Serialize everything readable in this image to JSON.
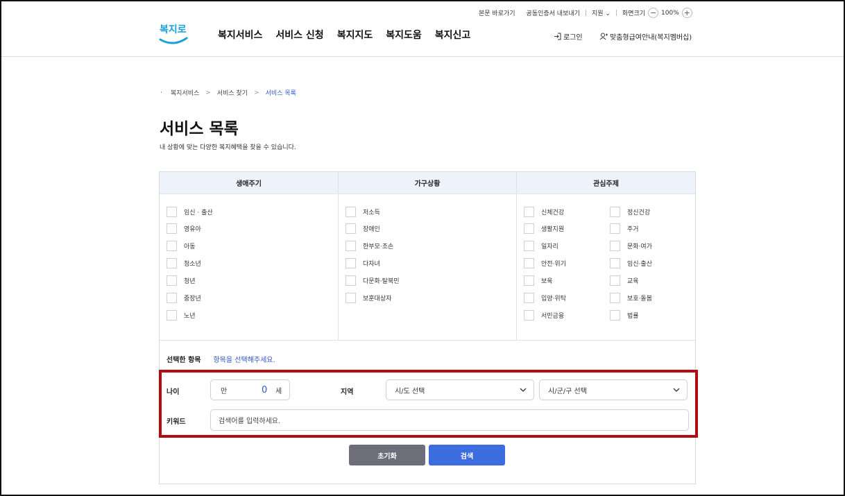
{
  "header": {
    "util": {
      "skip": "본문 바로가기",
      "cert": "공동인증서 내보내기",
      "support": "지원",
      "zoom_label": "화면크기",
      "zoom_minus": "−",
      "zoom_value": "100%",
      "zoom_plus": "+"
    },
    "logo_text": "복지로",
    "nav": [
      "복지서비스",
      "서비스 신청",
      "복지지도",
      "복지도움",
      "복지신고"
    ],
    "login": "로그인",
    "custom": "맞춤형급여안내(복지멤버십)"
  },
  "breadcrumb": {
    "bullet": "·",
    "items": [
      "복지서비스",
      "서비스 찾기",
      "서비스 목록"
    ],
    "separator": ">"
  },
  "page": {
    "title": "서비스 목록",
    "subtitle": "내 상황에 맞는 다양한 복지혜택을 찾을 수 있습니다."
  },
  "filters": {
    "life": {
      "title": "생애주기",
      "items": [
        "임신 · 출산",
        "영유아",
        "아동",
        "청소년",
        "청년",
        "중장년",
        "노년"
      ]
    },
    "household": {
      "title": "가구상황",
      "items": [
        "저소득",
        "장애인",
        "한부모·조손",
        "다자녀",
        "다문화·탈북민",
        "보훈대상자"
      ]
    },
    "interest": {
      "title": "관심주제",
      "left": [
        "신체건강",
        "생활지원",
        "일자리",
        "안전·위기",
        "보육",
        "입양·위탁",
        "서민금융"
      ],
      "right": [
        "정신건강",
        "주거",
        "문화·여가",
        "임신·출산",
        "교육",
        "보호·돌봄",
        "법률"
      ]
    }
  },
  "selected": {
    "label": "선택한 항목",
    "placeholder": "항목을 선택해주세요."
  },
  "age": {
    "label": "나이",
    "prefix": "만",
    "value": "0",
    "suffix": "세"
  },
  "region": {
    "label": "지역",
    "sido": "시/도 선택",
    "sigungu": "시/군/구 선택"
  },
  "keyword": {
    "label": "키워드",
    "placeholder": "검색어를 입력하세요."
  },
  "buttons": {
    "reset": "초기화",
    "search": "검색"
  },
  "colors": {
    "accent": "#3d6be0",
    "highlight": "#b30b12",
    "reset": "#6c6e7a"
  }
}
